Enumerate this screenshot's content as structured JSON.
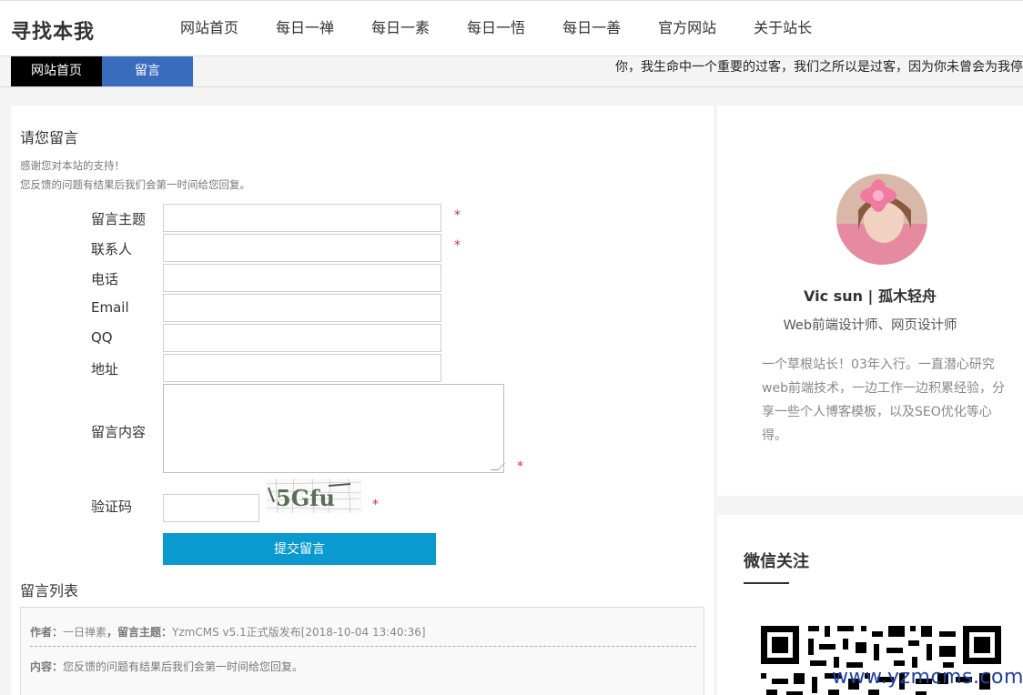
{
  "site": {
    "logo": "寻找本我"
  },
  "nav": [
    {
      "label": "网站首页"
    },
    {
      "label": "每日一禅"
    },
    {
      "label": "每日一素"
    },
    {
      "label": "每日一悟"
    },
    {
      "label": "每日一善"
    },
    {
      "label": "官方网站"
    },
    {
      "label": "关于站长"
    }
  ],
  "breadcrumb": {
    "home": "网站首页",
    "current": "留言"
  },
  "marquee": "你，我生命中一个重要的过客，我们之所以是过客，因为你未曾会为我停",
  "form": {
    "title": "请您留言",
    "intro_line1": "感谢您对本站的支持！",
    "intro_line2": "您反馈的问题有结果后我们会第一时间给您回复。",
    "required_mark": "*",
    "labels": {
      "subject": "留言主题",
      "contact": "联系人",
      "phone": "电话",
      "email": "Email",
      "qq": "QQ",
      "address": "地址",
      "content": "留言内容",
      "captcha": "验证码"
    },
    "captcha_text": "5Gfu",
    "submit": "提交留言"
  },
  "messages": {
    "title": "留言列表",
    "items": [
      {
        "author_label": "作者：",
        "author": "一日禅素",
        "subject_label": "，留言主题：",
        "subject": "YzmCMS v5.1正式版发布",
        "time": "[2018-10-04 13:40:36]",
        "content_label": "内容：",
        "content": "您反馈的问题有结果后我们会第一时间给您回复。"
      }
    ]
  },
  "author_card": {
    "name": "Vic sun | 孤木轻舟",
    "role": "Web前端设计师、网页设计师",
    "bio": "一个草根站长！03年入行。一直潜心研究web前端技术，一边工作一边积累经验，分享一些个人博客模板，以及SEO优化等心得。"
  },
  "wechat": {
    "title": "微信关注"
  },
  "watermark": "www.yzmcms.com",
  "colors": {
    "accent_blue": "#3a6cbe",
    "button": "#0a9ad0",
    "required": "#e03030"
  }
}
